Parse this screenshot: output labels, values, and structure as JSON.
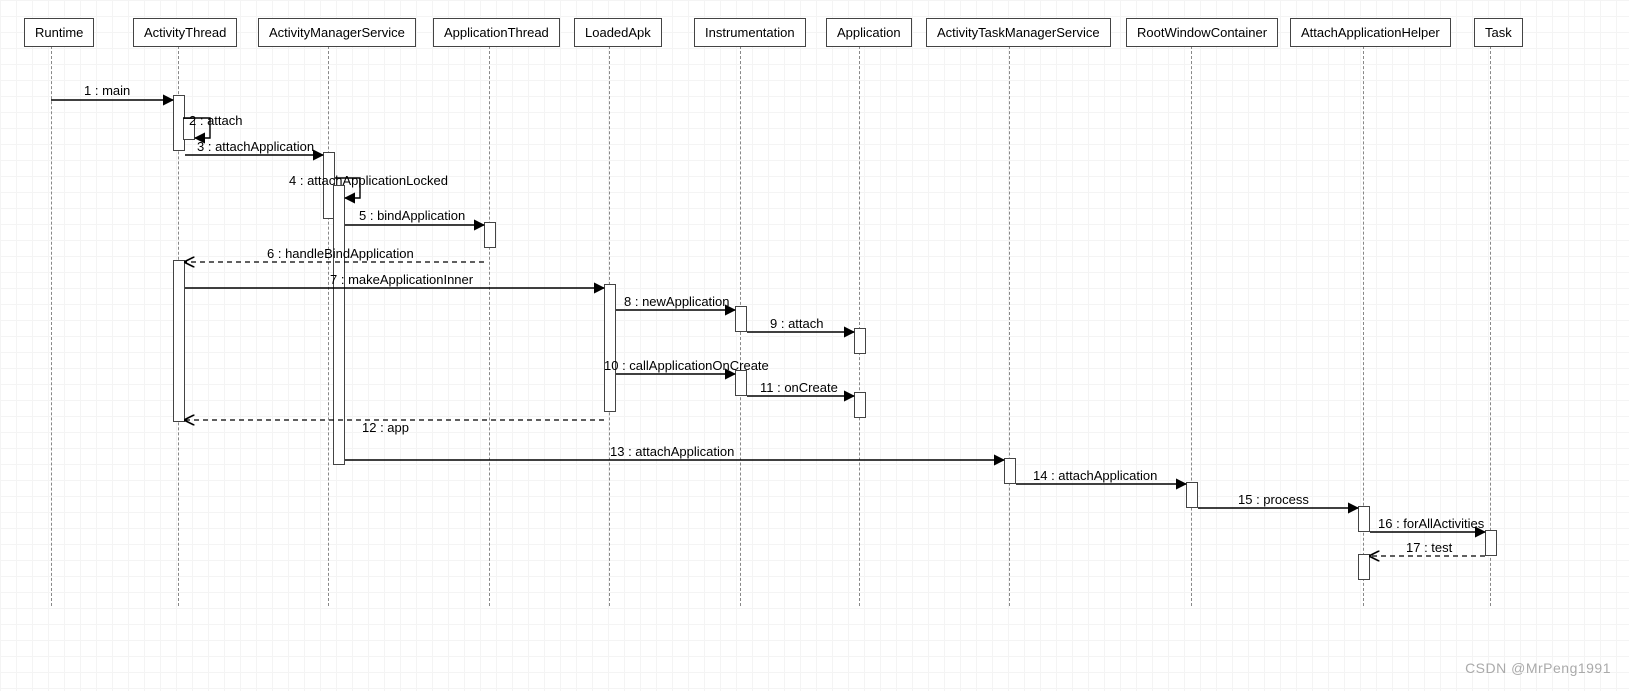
{
  "watermark": "CSDN @MrPeng1991",
  "participants": {
    "runtime": "Runtime",
    "activityThread": "ActivityThread",
    "activityManagerService": "ActivityManagerService",
    "applicationThread": "ApplicationThread",
    "loadedApk": "LoadedApk",
    "instrumentation": "Instrumentation",
    "application": "Application",
    "activityTaskManagerService": "ActivityTaskManagerService",
    "rootWindowContainer": "RootWindowContainer",
    "attachApplicationHelper": "AttachApplicationHelper",
    "task": "Task"
  },
  "messages": {
    "m1": "1 : main",
    "m2": "2 : attach",
    "m3": "3 : attachApplication",
    "m4": "4 : attachApplicationLocked",
    "m5": "5 : bindApplication",
    "m6": "6 : handleBindApplication",
    "m7": "7 : makeApplicationInner",
    "m8": "8 : newApplication",
    "m9": "9 : attach",
    "m10": "10 : callApplicationOnCreate",
    "m11": "11 : onCreate",
    "m12": "12 : app",
    "m13": "13 : attachApplication",
    "m14": "14 : attachApplication",
    "m15": "15 : process",
    "m16": "16 : forAllActivities",
    "m17": "17 : test"
  },
  "chart_data": {
    "type": "sequence-diagram",
    "participants": [
      "Runtime",
      "ActivityThread",
      "ActivityManagerService",
      "ApplicationThread",
      "LoadedApk",
      "Instrumentation",
      "Application",
      "ActivityTaskManagerService",
      "RootWindowContainer",
      "AttachApplicationHelper",
      "Task"
    ],
    "messages": [
      {
        "n": 1,
        "from": "Runtime",
        "to": "ActivityThread",
        "label": "main",
        "style": "sync"
      },
      {
        "n": 2,
        "from": "ActivityThread",
        "to": "ActivityThread",
        "label": "attach",
        "style": "self"
      },
      {
        "n": 3,
        "from": "ActivityThread",
        "to": "ActivityManagerService",
        "label": "attachApplication",
        "style": "sync"
      },
      {
        "n": 4,
        "from": "ActivityManagerService",
        "to": "ActivityManagerService",
        "label": "attachApplicationLocked",
        "style": "self"
      },
      {
        "n": 5,
        "from": "ActivityManagerService",
        "to": "ApplicationThread",
        "label": "bindApplication",
        "style": "sync"
      },
      {
        "n": 6,
        "from": "ApplicationThread",
        "to": "ActivityThread",
        "label": "handleBindApplication",
        "style": "return"
      },
      {
        "n": 7,
        "from": "ActivityThread",
        "to": "LoadedApk",
        "label": "makeApplicationInner",
        "style": "sync"
      },
      {
        "n": 8,
        "from": "LoadedApk",
        "to": "Instrumentation",
        "label": "newApplication",
        "style": "sync"
      },
      {
        "n": 9,
        "from": "Instrumentation",
        "to": "Application",
        "label": "attach",
        "style": "sync"
      },
      {
        "n": 10,
        "from": "LoadedApk",
        "to": "Instrumentation",
        "label": "callApplicationOnCreate",
        "style": "sync"
      },
      {
        "n": 11,
        "from": "Instrumentation",
        "to": "Application",
        "label": "onCreate",
        "style": "sync"
      },
      {
        "n": 12,
        "from": "LoadedApk",
        "to": "ActivityThread",
        "label": "app",
        "style": "return"
      },
      {
        "n": 13,
        "from": "ActivityManagerService",
        "to": "ActivityTaskManagerService",
        "label": "attachApplication",
        "style": "sync"
      },
      {
        "n": 14,
        "from": "ActivityTaskManagerService",
        "to": "RootWindowContainer",
        "label": "attachApplication",
        "style": "sync"
      },
      {
        "n": 15,
        "from": "RootWindowContainer",
        "to": "AttachApplicationHelper",
        "label": "process",
        "style": "sync"
      },
      {
        "n": 16,
        "from": "AttachApplicationHelper",
        "to": "Task",
        "label": "forAllActivities",
        "style": "sync"
      },
      {
        "n": 17,
        "from": "Task",
        "to": "AttachApplicationHelper",
        "label": "test",
        "style": "return"
      }
    ]
  }
}
